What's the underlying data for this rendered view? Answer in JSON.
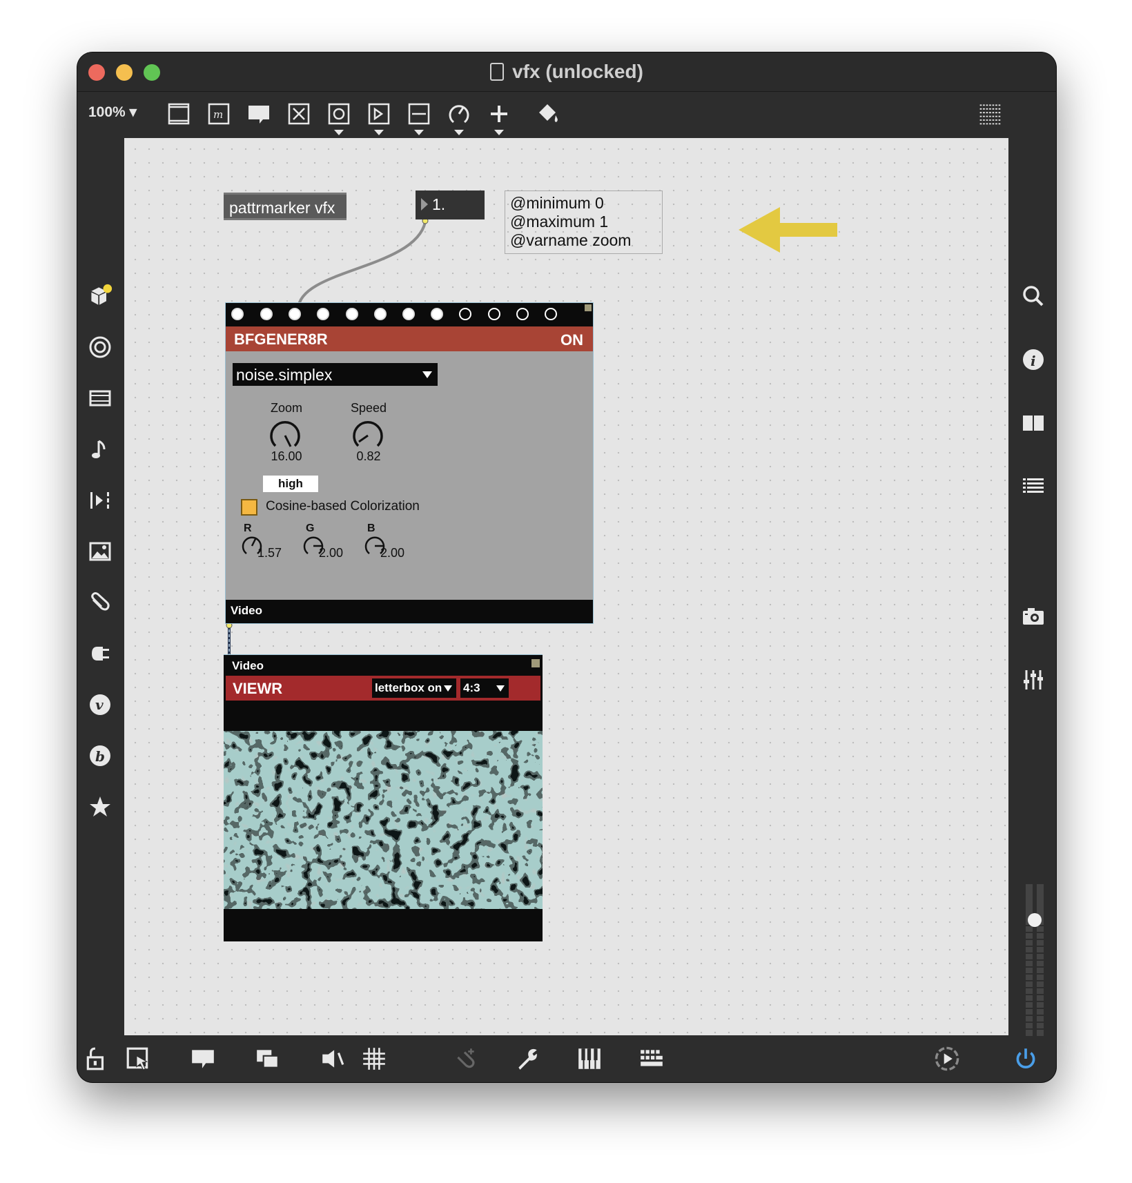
{
  "window": {
    "title": "vfx (unlocked)"
  },
  "toolbar": {
    "zoom_label": "100% ▾",
    "tools": [
      "new-object-icon",
      "message-icon",
      "comment-icon",
      "button-icon",
      "toggle-icon",
      "number-icon",
      "slider-icon",
      "dial-icon",
      "add-icon",
      "paint-bucket-icon"
    ],
    "grid_icon": "grid-icon"
  },
  "left_sidebar": [
    "packages-icon",
    "target-icon",
    "media-icon",
    "music-note-icon",
    "clips-icon",
    "image-icon",
    "paperclip-icon",
    "plug-icon",
    "vizzie-icon",
    "beap-icon",
    "star-icon"
  ],
  "right_sidebar": [
    "search-icon",
    "info-icon",
    "book-icon",
    "list-icon",
    "camera-icon",
    "mixer-icon"
  ],
  "bottom_toolbar": [
    "lock-icon",
    "presentation-icon",
    "comment-icon",
    "layers-icon",
    "mute-icon",
    "grid-icon",
    "attach-icon",
    "wrench-icon",
    "piano-icon",
    "keyboard-icon",
    "transport-icon",
    "power-icon"
  ],
  "patch": {
    "pattrmarker": {
      "label": "pattrmarker vfx"
    },
    "number_box": {
      "value": "1."
    },
    "comment": {
      "line1": "@minimum 0",
      "line2": "@maximum 1",
      "line3": "@varname zoom"
    },
    "annotation_arrow": {
      "color": "#e3c941"
    },
    "bfgener8r": {
      "title": "BFGENER8R",
      "state": "ON",
      "menu_value": "noise.simplex",
      "zoom": {
        "label": "Zoom",
        "value": "16.00"
      },
      "speed": {
        "label": "Speed",
        "value": "0.82"
      },
      "quality": "high",
      "colorize_label": "Cosine-based Colorization",
      "r": {
        "label": "R",
        "value": "1.57"
      },
      "g": {
        "label": "G",
        "value": "2.00"
      },
      "b": {
        "label": "B",
        "value": "2.00"
      },
      "outlet_label": "Video",
      "header_color": "#a84435"
    },
    "viewr": {
      "inlet_label": "Video",
      "title": "VIEWR",
      "letterbox": "letterbox on",
      "aspect": "4:3",
      "header_color": "#a32a2c"
    }
  }
}
